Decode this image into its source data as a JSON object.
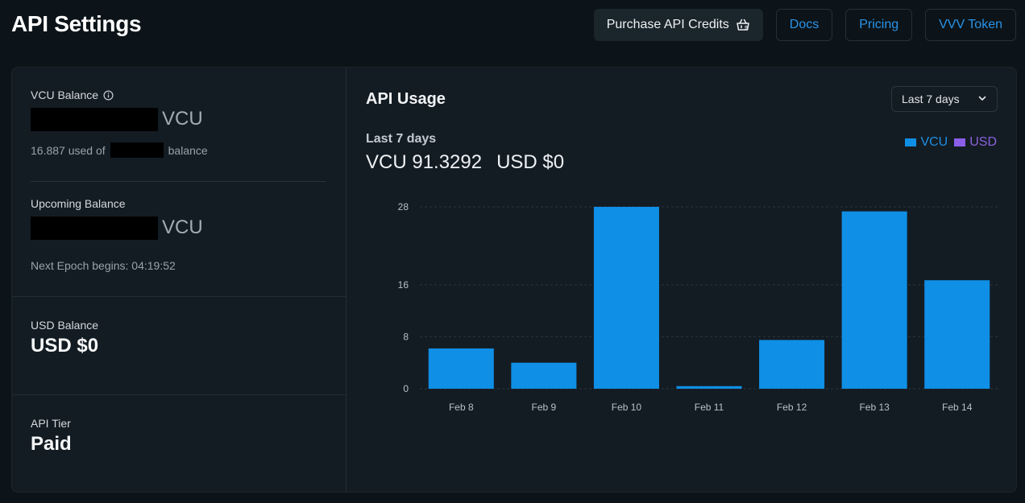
{
  "header": {
    "title": "API Settings",
    "buttons": {
      "purchase": "Purchase API Credits",
      "docs": "Docs",
      "pricing": "Pricing",
      "token": "VVV Token"
    }
  },
  "balances": {
    "vcu": {
      "label": "VCU Balance",
      "unit": "VCU",
      "used_prefix": "16.887 used of",
      "used_suffix": "balance"
    },
    "upcoming": {
      "label": "Upcoming Balance",
      "unit": "VCU",
      "epoch": "Next Epoch begins: 04:19:52"
    },
    "usd": {
      "label": "USD Balance",
      "value": "USD $0"
    },
    "tier": {
      "label": "API Tier",
      "value": "Paid"
    }
  },
  "usage": {
    "title": "API Usage",
    "range_select": "Last 7 days",
    "period_label": "Last 7 days",
    "total_vcu": "VCU 91.3292",
    "total_usd": "USD $0",
    "legend": [
      "VCU",
      "USD"
    ]
  },
  "colors": {
    "vcu": "#0f8fe6",
    "usd": "#8a5ee8",
    "link": "#2a93e8"
  },
  "chart_data": {
    "type": "bar",
    "categories": [
      "Feb 8",
      "Feb 9",
      "Feb 10",
      "Feb 11",
      "Feb 12",
      "Feb 13",
      "Feb 14"
    ],
    "series": [
      {
        "name": "VCU",
        "values": [
          6.2,
          4.0,
          28.0,
          0.4,
          7.5,
          27.3,
          16.7
        ]
      },
      {
        "name": "USD",
        "values": [
          0,
          0,
          0,
          0,
          0,
          0,
          0
        ]
      }
    ],
    "yticks": [
      0,
      8,
      16,
      28
    ],
    "ylim": [
      0,
      28
    ],
    "grid": true,
    "legend_position": "top-right"
  }
}
